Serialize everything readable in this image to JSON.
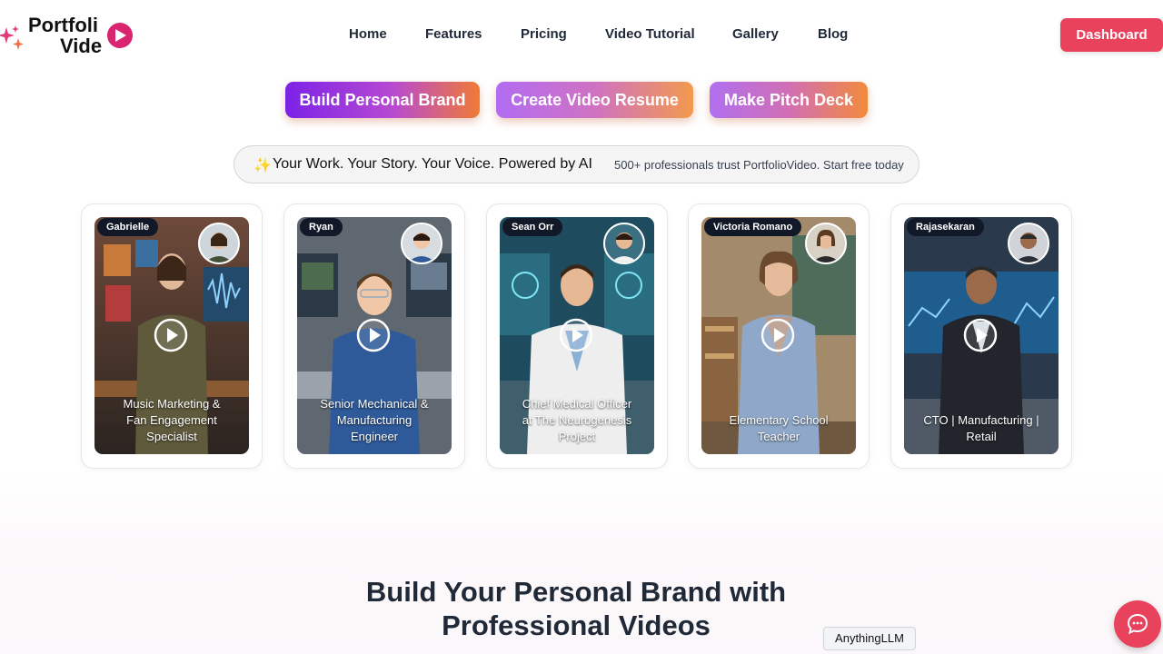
{
  "brand": {
    "line1": "Portfoli",
    "line2": "Vide"
  },
  "nav": {
    "items": [
      "Home",
      "Features",
      "Pricing",
      "Video Tutorial",
      "Gallery",
      "Blog"
    ],
    "dashboard_label": "Dashboard"
  },
  "cta": {
    "build_brand": "Build Personal Brand",
    "video_resume": "Create Video Resume",
    "pitch_deck": "Make Pitch Deck"
  },
  "trust": {
    "icon": "sparkle-star-icon",
    "headline": "Your Work. Your Story. Your Voice. Powered by AI",
    "subtext": "500+ professionals trust PortfolioVideo. Start free today"
  },
  "cards": [
    {
      "name": "Gabrielle",
      "role": "Music Marketing & Fan Engagement Specialist"
    },
    {
      "name": "Ryan",
      "role": "Senior Mechanical & Manufacturing Engineer"
    },
    {
      "name": "Sean Orr",
      "role": "Chief Medical Officer at The Neurogenesis Project"
    },
    {
      "name": "Victoria Romano",
      "role": "Elementary School Teacher"
    },
    {
      "name": "Rajasekaran",
      "role": "CTO | Manufacturing | Retail"
    }
  ],
  "section": {
    "heading_line1": "Build Your Personal Brand with",
    "heading_line2": "Professional Videos"
  },
  "chat": {
    "icon": "chat-bubble-icon",
    "tooltip": "AnythingLLM"
  },
  "colors": {
    "primary": "#e9425d",
    "play_accent": "#d9246f",
    "gradient_start": "#7c22e6",
    "gradient_end": "#f07b36"
  }
}
